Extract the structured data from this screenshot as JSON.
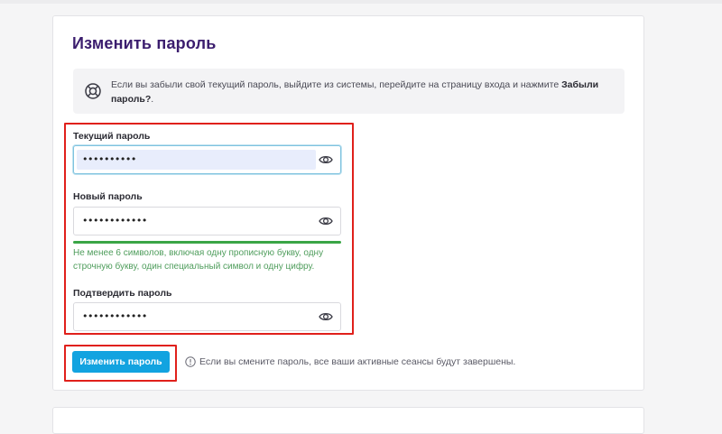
{
  "page": {
    "title": "Изменить пароль"
  },
  "info": {
    "text_before": "Если вы забыли свой текущий пароль, выйдите из системы, перейдите на страницу входа и нажмите ",
    "link_text": "Забыли пароль?",
    "text_after": ".",
    "icon": "lifebuoy-icon"
  },
  "form": {
    "current_password": {
      "label": "Текущий пароль",
      "value": "••••••••••",
      "icon": "eye-icon"
    },
    "new_password": {
      "label": "Новый пароль",
      "value": "••••••••••••",
      "icon": "eye-icon",
      "strength": 1.0,
      "hint": "Не менее 6 символов, включая одну прописную букву, одну строчную букву, один специальный символ и одну цифру."
    },
    "confirm_password": {
      "label": "Подтвердить пароль",
      "value": "••••••••••••",
      "icon": "eye-icon"
    }
  },
  "actions": {
    "submit_label": "Изменить пароль",
    "warning_icon": "info-circle-icon",
    "warning_text": "Если вы смените пароль, все ваши активные сеансы будут завершены."
  },
  "colors": {
    "title": "#3b1d6e",
    "accent_button": "#12a3e0",
    "strength_ok": "#3aa546",
    "hint_text": "#4f9d5c",
    "highlight_frame": "#e0201b"
  }
}
